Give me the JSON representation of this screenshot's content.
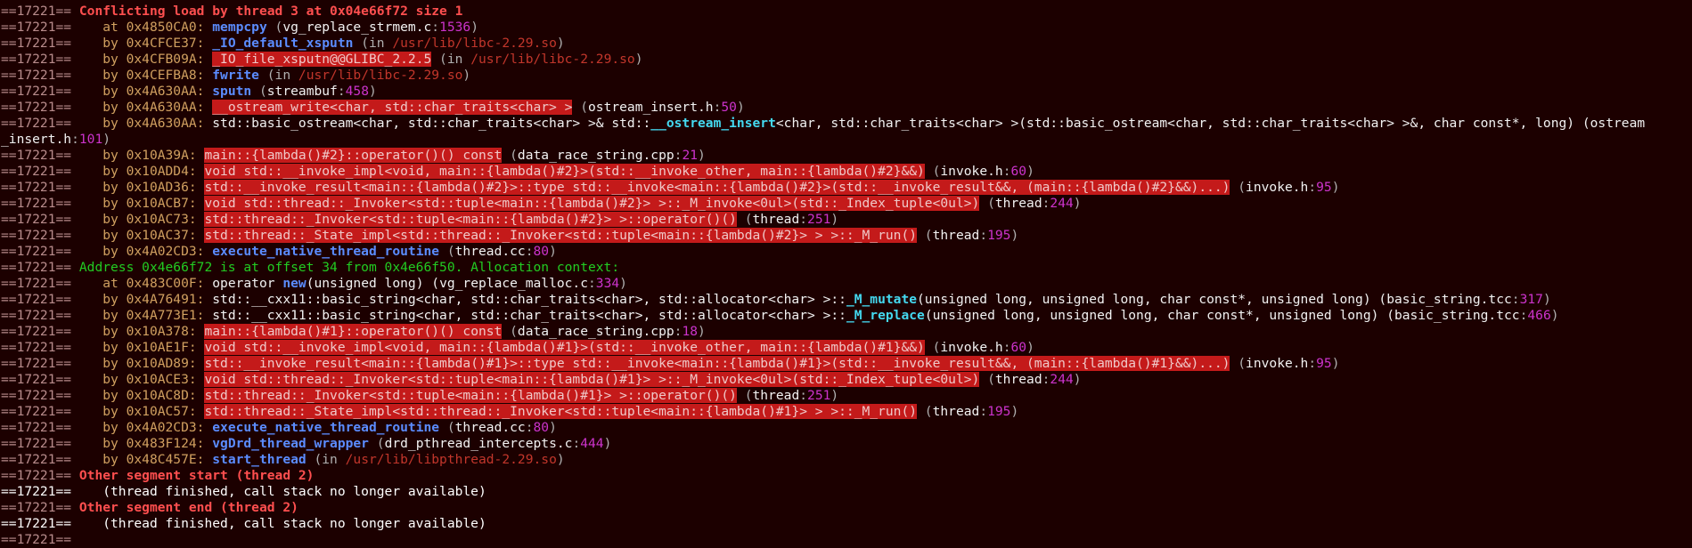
{
  "terminal": {
    "lines": [
      [
        {
          "t": "==17221== ",
          "c": "prefix"
        },
        {
          "t": "Conflicting load by thread 3 at 0x04e66f72 size 1",
          "c": "header-red"
        }
      ],
      [
        {
          "t": "==17221==    ",
          "c": "prefix"
        },
        {
          "t": "at 0x4850CA0: ",
          "c": "bytext"
        },
        {
          "t": "mempcpy",
          "c": "func"
        },
        {
          "t": " (",
          "c": "dim"
        },
        {
          "t": "vg_replace_strmem.c",
          "c": "file"
        },
        {
          "t": ":",
          "c": "dim"
        },
        {
          "t": "1536",
          "c": "num"
        },
        {
          "t": ")",
          "c": "dim"
        }
      ],
      [
        {
          "t": "==17221==    ",
          "c": "prefix"
        },
        {
          "t": "by 0x4CFCE37: ",
          "c": "bytext"
        },
        {
          "t": "_IO_default_xsputn",
          "c": "func"
        },
        {
          "t": " (in ",
          "c": "dim"
        },
        {
          "t": "/usr/lib/libc-2.29.so",
          "c": "path"
        },
        {
          "t": ")",
          "c": "dim"
        }
      ],
      [
        {
          "t": "==17221==    ",
          "c": "prefix"
        },
        {
          "t": "by 0x4CFB09A: ",
          "c": "bytext"
        },
        {
          "t": "_IO_file_xsputn@@GLIBC_2.2.5",
          "c": "errbg"
        },
        {
          "t": " (in ",
          "c": "dim"
        },
        {
          "t": "/usr/lib/libc-2.29.so",
          "c": "path"
        },
        {
          "t": ")",
          "c": "dim"
        }
      ],
      [
        {
          "t": "==17221==    ",
          "c": "prefix"
        },
        {
          "t": "by 0x4CEFBA8: ",
          "c": "bytext"
        },
        {
          "t": "fwrite",
          "c": "func"
        },
        {
          "t": " (in ",
          "c": "dim"
        },
        {
          "t": "/usr/lib/libc-2.29.so",
          "c": "path"
        },
        {
          "t": ")",
          "c": "dim"
        }
      ],
      [
        {
          "t": "==17221==    ",
          "c": "prefix"
        },
        {
          "t": "by 0x4A630AA: ",
          "c": "bytext"
        },
        {
          "t": "sputn",
          "c": "func"
        },
        {
          "t": " (",
          "c": "dim"
        },
        {
          "t": "streambuf",
          "c": "file"
        },
        {
          "t": ":",
          "c": "dim"
        },
        {
          "t": "458",
          "c": "num"
        },
        {
          "t": ")",
          "c": "dim"
        }
      ],
      [
        {
          "t": "==17221==    ",
          "c": "prefix"
        },
        {
          "t": "by 0x4A630AA: ",
          "c": "bytext"
        },
        {
          "t": "__ostream_write<char, std::char_traits<char> >",
          "c": "errbg"
        },
        {
          "t": " (",
          "c": "dim"
        },
        {
          "t": "ostream_insert.h",
          "c": "file"
        },
        {
          "t": ":",
          "c": "dim"
        },
        {
          "t": "50",
          "c": "num"
        },
        {
          "t": ")",
          "c": "dim"
        }
      ],
      [
        {
          "t": "==17221==    ",
          "c": "prefix"
        },
        {
          "t": "by 0x4A630AA: ",
          "c": "bytext"
        },
        {
          "t": "std::basic_ostream<char, std::char_traits<char> >& std::",
          "c": "plain"
        },
        {
          "t": "__ostream_insert",
          "c": "cyanbold"
        },
        {
          "t": "<char, std::char_traits<char> >(std::basic_ostream<char, std::char_traits<char> >&, char const*, long) (",
          "c": "plain"
        },
        {
          "t": "ostream",
          "c": "file"
        }
      ],
      [
        {
          "t": "_insert.h",
          "c": "file"
        },
        {
          "t": ":",
          "c": "dim"
        },
        {
          "t": "101",
          "c": "num"
        },
        {
          "t": ")",
          "c": "dim"
        }
      ],
      [
        {
          "t": "==17221==    ",
          "c": "prefix"
        },
        {
          "t": "by 0x10A39A: ",
          "c": "bytext"
        },
        {
          "t": "main::{lambda()#2}::operator()() const",
          "c": "errbg"
        },
        {
          "t": " (",
          "c": "dim"
        },
        {
          "t": "data_race_string.cpp",
          "c": "file"
        },
        {
          "t": ":",
          "c": "dim"
        },
        {
          "t": "21",
          "c": "num"
        },
        {
          "t": ")",
          "c": "dim"
        }
      ],
      [
        {
          "t": "==17221==    ",
          "c": "prefix"
        },
        {
          "t": "by 0x10ADD4: ",
          "c": "bytext"
        },
        {
          "t": "void std::__invoke_impl<void, main::{lambda()#2}>(std::__invoke_other, main::{lambda()#2}&&)",
          "c": "errbg"
        },
        {
          "t": " (",
          "c": "dim"
        },
        {
          "t": "invoke.h",
          "c": "file"
        },
        {
          "t": ":",
          "c": "dim"
        },
        {
          "t": "60",
          "c": "num"
        },
        {
          "t": ")",
          "c": "dim"
        }
      ],
      [
        {
          "t": "==17221==    ",
          "c": "prefix"
        },
        {
          "t": "by 0x10AD36: ",
          "c": "bytext"
        },
        {
          "t": "std::__invoke_result<main::{lambda()#2}>::type std::__invoke<main::{lambda()#2}>(std::__invoke_result&&, (main::{lambda()#2}&&)...)",
          "c": "errbg"
        },
        {
          "t": " (",
          "c": "dim"
        },
        {
          "t": "invoke.h",
          "c": "file"
        },
        {
          "t": ":",
          "c": "dim"
        },
        {
          "t": "95",
          "c": "num"
        },
        {
          "t": ")",
          "c": "dim"
        }
      ],
      [
        {
          "t": "==17221==    ",
          "c": "prefix"
        },
        {
          "t": "by 0x10ACB7: ",
          "c": "bytext"
        },
        {
          "t": "void std::thread::_Invoker<std::tuple<main::{lambda()#2}> >::_M_invoke<0ul>(std::_Index_tuple<0ul>)",
          "c": "errbg"
        },
        {
          "t": " (",
          "c": "dim"
        },
        {
          "t": "thread",
          "c": "file"
        },
        {
          "t": ":",
          "c": "dim"
        },
        {
          "t": "244",
          "c": "num"
        },
        {
          "t": ")",
          "c": "dim"
        }
      ],
      [
        {
          "t": "==17221==    ",
          "c": "prefix"
        },
        {
          "t": "by 0x10AC73: ",
          "c": "bytext"
        },
        {
          "t": "std::thread::_Invoker<std::tuple<main::{lambda()#2}> >::operator()()",
          "c": "errbg"
        },
        {
          "t": " (",
          "c": "dim"
        },
        {
          "t": "thread",
          "c": "file"
        },
        {
          "t": ":",
          "c": "dim"
        },
        {
          "t": "251",
          "c": "num"
        },
        {
          "t": ")",
          "c": "dim"
        }
      ],
      [
        {
          "t": "==17221==    ",
          "c": "prefix"
        },
        {
          "t": "by 0x10AC37: ",
          "c": "bytext"
        },
        {
          "t": "std::thread::_State_impl<std::thread::_Invoker<std::tuple<main::{lambda()#2}> > >::_M_run()",
          "c": "errbg"
        },
        {
          "t": " (",
          "c": "dim"
        },
        {
          "t": "thread",
          "c": "file"
        },
        {
          "t": ":",
          "c": "dim"
        },
        {
          "t": "195",
          "c": "num"
        },
        {
          "t": ")",
          "c": "dim"
        }
      ],
      [
        {
          "t": "==17221==    ",
          "c": "prefix"
        },
        {
          "t": "by 0x4A02CD3: ",
          "c": "bytext"
        },
        {
          "t": "execute_native_thread_routine",
          "c": "func"
        },
        {
          "t": " (",
          "c": "dim"
        },
        {
          "t": "thread.cc",
          "c": "file"
        },
        {
          "t": ":",
          "c": "dim"
        },
        {
          "t": "80",
          "c": "num"
        },
        {
          "t": ")",
          "c": "dim"
        }
      ],
      [
        {
          "t": "==17221== ",
          "c": "prefix"
        },
        {
          "t": "Address 0x4e66f72 is at offset 34 from 0x4e66f50. Allocation context:",
          "c": "header-green"
        }
      ],
      [
        {
          "t": "==17221==    ",
          "c": "prefix"
        },
        {
          "t": "at 0x483C00F: ",
          "c": "bytext"
        },
        {
          "t": "operator ",
          "c": "plain"
        },
        {
          "t": "new",
          "c": "func"
        },
        {
          "t": "(unsigned long) (",
          "c": "plain"
        },
        {
          "t": "vg_replace_malloc.c",
          "c": "file"
        },
        {
          "t": ":",
          "c": "dim"
        },
        {
          "t": "334",
          "c": "num"
        },
        {
          "t": ")",
          "c": "dim"
        }
      ],
      [
        {
          "t": "==17221==    ",
          "c": "prefix"
        },
        {
          "t": "by 0x4A76491: ",
          "c": "bytext"
        },
        {
          "t": "std::__cxx11::basic_string<char, std::char_traits<char>, std::allocator<char> >::",
          "c": "plain"
        },
        {
          "t": "_M_mutate",
          "c": "cyanbold"
        },
        {
          "t": "(unsigned long, unsigned long, char const*, unsigned long) (",
          "c": "plain"
        },
        {
          "t": "basic_string.tcc",
          "c": "file"
        },
        {
          "t": ":",
          "c": "dim"
        },
        {
          "t": "317",
          "c": "num"
        },
        {
          "t": ")",
          "c": "dim"
        }
      ],
      [
        {
          "t": "==17221==    ",
          "c": "prefix"
        },
        {
          "t": "by 0x4A773E1: ",
          "c": "bytext"
        },
        {
          "t": "std::__cxx11::basic_string<char, std::char_traits<char>, std::allocator<char> >::",
          "c": "plain"
        },
        {
          "t": "_M_replace",
          "c": "cyanbold"
        },
        {
          "t": "(unsigned long, unsigned long, char const*, unsigned long) (",
          "c": "plain"
        },
        {
          "t": "basic_string.tcc",
          "c": "file"
        },
        {
          "t": ":",
          "c": "dim"
        },
        {
          "t": "466",
          "c": "num"
        },
        {
          "t": ")",
          "c": "dim"
        }
      ],
      [
        {
          "t": "==17221==    ",
          "c": "prefix"
        },
        {
          "t": "by 0x10A378: ",
          "c": "bytext"
        },
        {
          "t": "main::{lambda()#1}::operator()() const",
          "c": "errbg"
        },
        {
          "t": " (",
          "c": "dim"
        },
        {
          "t": "data_race_string.cpp",
          "c": "file"
        },
        {
          "t": ":",
          "c": "dim"
        },
        {
          "t": "18",
          "c": "num"
        },
        {
          "t": ")",
          "c": "dim"
        }
      ],
      [
        {
          "t": "==17221==    ",
          "c": "prefix"
        },
        {
          "t": "by 0x10AE1F: ",
          "c": "bytext"
        },
        {
          "t": "void std::__invoke_impl<void, main::{lambda()#1}>(std::__invoke_other, main::{lambda()#1}&&)",
          "c": "errbg"
        },
        {
          "t": " (",
          "c": "dim"
        },
        {
          "t": "invoke.h",
          "c": "file"
        },
        {
          "t": ":",
          "c": "dim"
        },
        {
          "t": "60",
          "c": "num"
        },
        {
          "t": ")",
          "c": "dim"
        }
      ],
      [
        {
          "t": "==17221==    ",
          "c": "prefix"
        },
        {
          "t": "by 0x10AD89: ",
          "c": "bytext"
        },
        {
          "t": "std::__invoke_result<main::{lambda()#1}>::type std::__invoke<main::{lambda()#1}>(std::__invoke_result&&, (main::{lambda()#1}&&)...)",
          "c": "errbg"
        },
        {
          "t": " (",
          "c": "dim"
        },
        {
          "t": "invoke.h",
          "c": "file"
        },
        {
          "t": ":",
          "c": "dim"
        },
        {
          "t": "95",
          "c": "num"
        },
        {
          "t": ")",
          "c": "dim"
        }
      ],
      [
        {
          "t": "==17221==    ",
          "c": "prefix"
        },
        {
          "t": "by 0x10ACE3: ",
          "c": "bytext"
        },
        {
          "t": "void std::thread::_Invoker<std::tuple<main::{lambda()#1}> >::_M_invoke<0ul>(std::_Index_tuple<0ul>)",
          "c": "errbg"
        },
        {
          "t": " (",
          "c": "dim"
        },
        {
          "t": "thread",
          "c": "file"
        },
        {
          "t": ":",
          "c": "dim"
        },
        {
          "t": "244",
          "c": "num"
        },
        {
          "t": ")",
          "c": "dim"
        }
      ],
      [
        {
          "t": "==17221==    ",
          "c": "prefix"
        },
        {
          "t": "by 0x10AC8D: ",
          "c": "bytext"
        },
        {
          "t": "std::thread::_Invoker<std::tuple<main::{lambda()#1}> >::operator()()",
          "c": "errbg"
        },
        {
          "t": " (",
          "c": "dim"
        },
        {
          "t": "thread",
          "c": "file"
        },
        {
          "t": ":",
          "c": "dim"
        },
        {
          "t": "251",
          "c": "num"
        },
        {
          "t": ")",
          "c": "dim"
        }
      ],
      [
        {
          "t": "==17221==    ",
          "c": "prefix"
        },
        {
          "t": "by 0x10AC57: ",
          "c": "bytext"
        },
        {
          "t": "std::thread::_State_impl<std::thread::_Invoker<std::tuple<main::{lambda()#1}> > >::_M_run()",
          "c": "errbg"
        },
        {
          "t": " (",
          "c": "dim"
        },
        {
          "t": "thread",
          "c": "file"
        },
        {
          "t": ":",
          "c": "dim"
        },
        {
          "t": "195",
          "c": "num"
        },
        {
          "t": ")",
          "c": "dim"
        }
      ],
      [
        {
          "t": "==17221==    ",
          "c": "prefix"
        },
        {
          "t": "by 0x4A02CD3: ",
          "c": "bytext"
        },
        {
          "t": "execute_native_thread_routine",
          "c": "func"
        },
        {
          "t": " (",
          "c": "dim"
        },
        {
          "t": "thread.cc",
          "c": "file"
        },
        {
          "t": ":",
          "c": "dim"
        },
        {
          "t": "80",
          "c": "num"
        },
        {
          "t": ")",
          "c": "dim"
        }
      ],
      [
        {
          "t": "==17221==    ",
          "c": "prefix"
        },
        {
          "t": "by 0x483F124: ",
          "c": "bytext"
        },
        {
          "t": "vgDrd_thread_wrapper",
          "c": "func"
        },
        {
          "t": " (",
          "c": "dim"
        },
        {
          "t": "drd_pthread_intercepts.c",
          "c": "file"
        },
        {
          "t": ":",
          "c": "dim"
        },
        {
          "t": "444",
          "c": "num"
        },
        {
          "t": ")",
          "c": "dim"
        }
      ],
      [
        {
          "t": "==17221==    ",
          "c": "prefix"
        },
        {
          "t": "by 0x48C457E: ",
          "c": "bytext"
        },
        {
          "t": "start_thread",
          "c": "func"
        },
        {
          "t": " (in ",
          "c": "dim"
        },
        {
          "t": "/usr/lib/libpthread-2.29.so",
          "c": "path"
        },
        {
          "t": ")",
          "c": "dim"
        }
      ],
      [
        {
          "t": "==17221== ",
          "c": "prefix"
        },
        {
          "t": "Other segment start (thread 2)",
          "c": "header-red"
        }
      ],
      [
        {
          "t": "==17221==    ",
          "c": "prefix-bright"
        },
        {
          "t": "(thread finished, call stack no longer available)",
          "c": "bright-white"
        }
      ],
      [
        {
          "t": "==17221== ",
          "c": "prefix"
        },
        {
          "t": "Other segment end (thread 2)",
          "c": "header-red"
        }
      ],
      [
        {
          "t": "==17221==    ",
          "c": "prefix-bright"
        },
        {
          "t": "(thread finished, call stack no longer available)",
          "c": "bright-white"
        }
      ],
      [
        {
          "t": "==17221==",
          "c": "prefix"
        }
      ]
    ]
  }
}
